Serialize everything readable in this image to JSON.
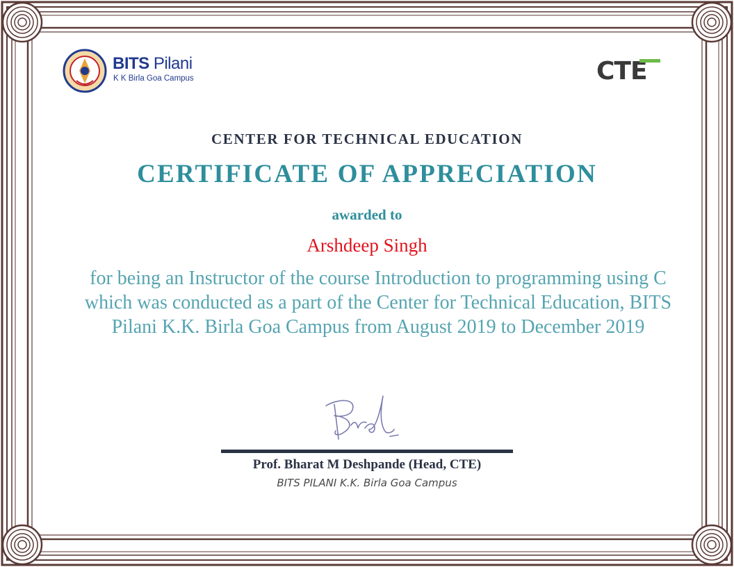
{
  "logo_left": {
    "name": "BITS",
    "name_suffix": "Pilani",
    "subtitle": "K K Birla Goa Campus",
    "seal_text": "BIRLA INSTITUTE OF TECHNOLOGY & SCIENCE PILANI"
  },
  "logo_right": {
    "text": "CTE"
  },
  "header": {
    "org": "CENTER FOR TECHNICAL EDUCATION",
    "title": "CERTIFICATE OF APPRECIATION"
  },
  "body": {
    "awarded_to": "awarded to",
    "recipient": "Arshdeep Singh",
    "citation": "for being an Instructor of the course Introduction to programming using C which was conducted as a part of the Center for Technical Education, BITS Pilani K.K. Birla Goa Campus from August 2019 to December 2019"
  },
  "signature": {
    "name": "Prof. Bharat M Deshpande (Head, CTE)",
    "org": "BITS PILANI K.K. Birla Goa Campus"
  },
  "colors": {
    "border": "#5a3a36",
    "teal": "#2e8e9c",
    "citation": "#55a4b1",
    "recipient": "#e0121b",
    "dark": "#2a3244"
  }
}
